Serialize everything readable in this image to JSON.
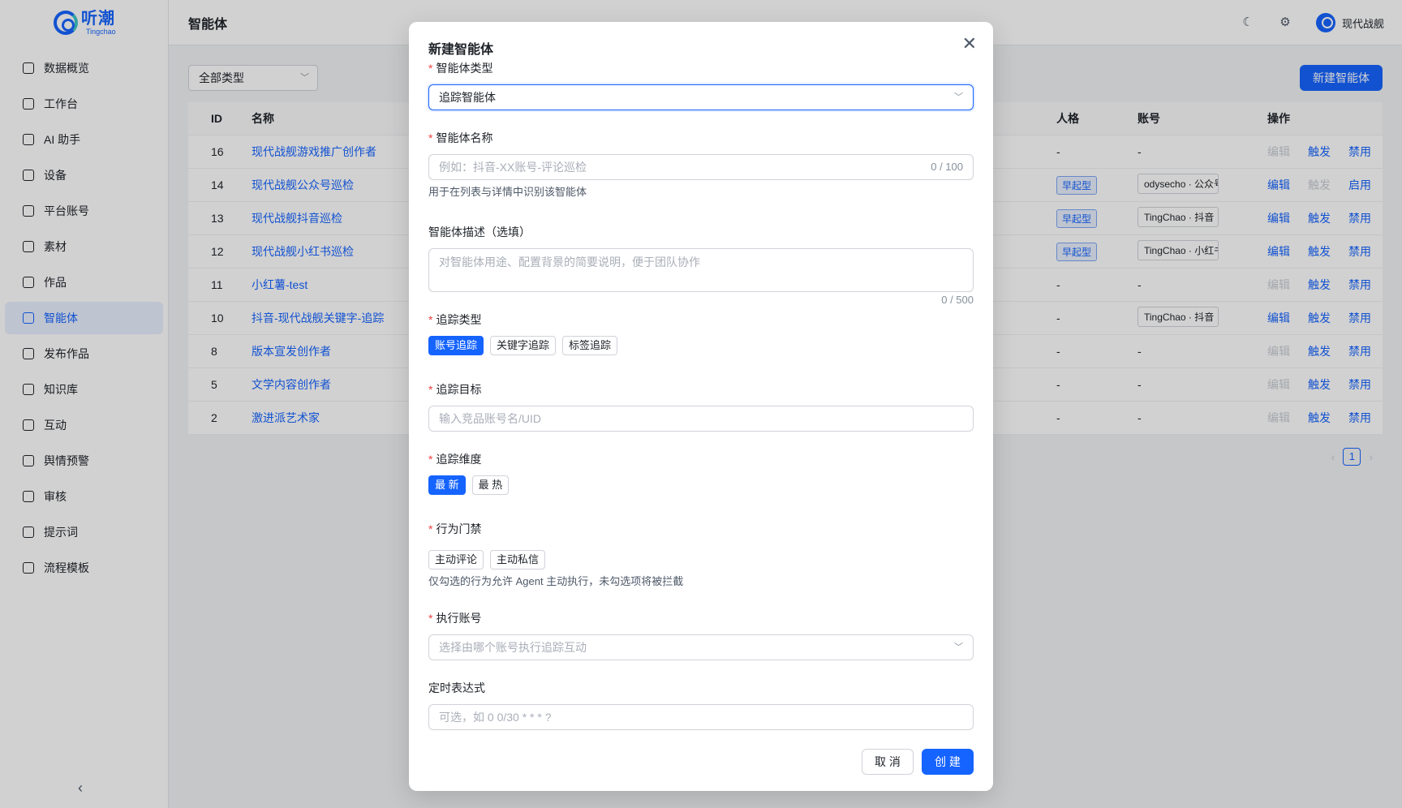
{
  "app": {
    "logo_cn": "听潮",
    "logo_en": "Tingchao"
  },
  "sidebar": {
    "items": [
      {
        "label": "数据概览"
      },
      {
        "label": "工作台"
      },
      {
        "label": "AI 助手"
      },
      {
        "label": "设备"
      },
      {
        "label": "平台账号"
      },
      {
        "label": "素材"
      },
      {
        "label": "作品"
      },
      {
        "label": "智能体"
      },
      {
        "label": "发布作品"
      },
      {
        "label": "知识库"
      },
      {
        "label": "互动"
      },
      {
        "label": "舆情预警"
      },
      {
        "label": "审核"
      },
      {
        "label": "提示词"
      },
      {
        "label": "流程模板"
      }
    ],
    "active_index": 7,
    "collapse_glyph": "‹"
  },
  "header": {
    "title": "智能体",
    "user": "现代战舰"
  },
  "toolbar": {
    "type_filter": "全部类型",
    "new_button": "新建智能体"
  },
  "table": {
    "columns": {
      "id": "ID",
      "name": "名称",
      "persona": "人格",
      "account": "账号",
      "ops": "操作"
    },
    "rows": [
      {
        "id": "16",
        "name": "现代战舰游戏推广创作者",
        "persona": "-",
        "account": "-",
        "op1": "编辑",
        "op2": "触发",
        "op3": "禁用"
      },
      {
        "id": "14",
        "name": "现代战舰公众号巡检",
        "persona": "早起型",
        "account": "odysecho · 公众号",
        "op1": "编辑",
        "op2": "触发",
        "op3": "启用"
      },
      {
        "id": "13",
        "name": "现代战舰抖音巡检",
        "persona": "早起型",
        "account": "TingChao · 抖音",
        "op1": "编辑",
        "op2": "触发",
        "op3": "禁用"
      },
      {
        "id": "12",
        "name": "现代战舰小红书巡检",
        "persona": "早起型",
        "account": "TingChao · 小红书",
        "op1": "编辑",
        "op2": "触发",
        "op3": "禁用"
      },
      {
        "id": "11",
        "name": "小红薯-test",
        "persona": "-",
        "account": "-",
        "op1": "编辑",
        "op2": "触发",
        "op3": "禁用"
      },
      {
        "id": "10",
        "name": "抖音-现代战舰关键字-追踪",
        "persona": "-",
        "account": "TingChao · 抖音",
        "op1": "编辑",
        "op2": "触发",
        "op3": "禁用"
      },
      {
        "id": "8",
        "name": "版本宣发创作者",
        "persona": "-",
        "account": "-",
        "op1": "编辑",
        "op2": "触发",
        "op3": "禁用"
      },
      {
        "id": "5",
        "name": "文学内容创作者",
        "persona": "-",
        "account": "-",
        "op1": "编辑",
        "op2": "触发",
        "op3": "禁用"
      },
      {
        "id": "2",
        "name": "激进派艺术家",
        "persona": "-",
        "account": "-",
        "op1": "编辑",
        "op2": "触发",
        "op3": "禁用"
      }
    ],
    "page": "1"
  },
  "modal": {
    "title": "新建智能体",
    "close_glyph": "✕",
    "type_label": "智能体类型",
    "type_value": "追踪智能体",
    "name_label": "智能体名称",
    "name_placeholder": "例如：抖音-XX账号-评论巡检",
    "name_count": "0 / 100",
    "name_hint": "用于在列表与详情中识别该智能体",
    "desc_label": "智能体描述（选填）",
    "desc_placeholder": "对智能体用途、配置背景的简要说明，便于团队协作",
    "desc_count": "0 / 500",
    "track_type_label": "追踪类型",
    "track_types": [
      "账号追踪",
      "关键字追踪",
      "标签追踪"
    ],
    "target_label": "追踪目标",
    "target_placeholder": "输入竞品账号名/UID",
    "dim_label": "追踪维度",
    "dims": [
      "最 新",
      "最 热"
    ],
    "gate_label": "行为门禁",
    "gates": [
      "主动评论",
      "主动私信"
    ],
    "gate_hint": "仅勾选的行为允许 Agent 主动执行，未勾选项将被拦截",
    "exec_label": "执行账号",
    "exec_placeholder": "选择由哪个账号执行追踪互动",
    "cron_label": "定时表达式",
    "cron_placeholder": "可选，如 0 0/30 * * * ?",
    "cancel": "取 消",
    "create": "创 建"
  }
}
